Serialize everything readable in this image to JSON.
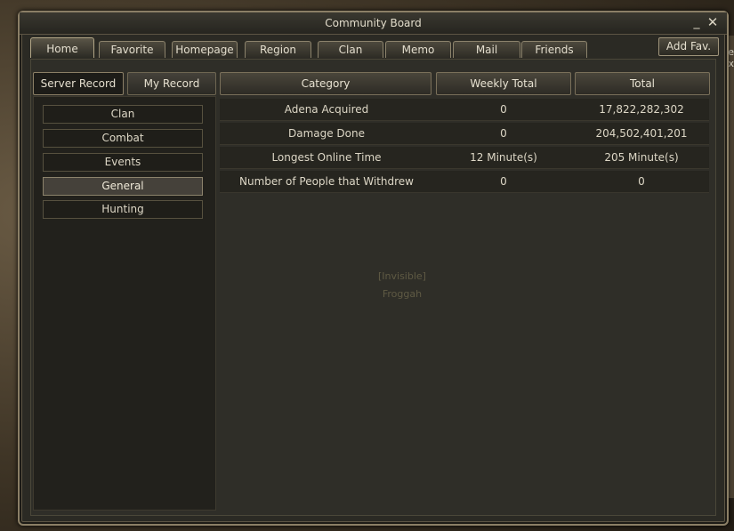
{
  "window": {
    "title": "Community Board"
  },
  "controls": {
    "minimize": "_",
    "close": "✕"
  },
  "tabs": [
    {
      "label": "Home",
      "active": true
    },
    {
      "label": "Favorite",
      "active": false
    },
    {
      "label": "Homepage",
      "active": false
    },
    {
      "label": "Region",
      "active": false
    },
    {
      "label": "Clan",
      "active": false
    },
    {
      "label": "Memo",
      "active": false
    },
    {
      "label": "Mail",
      "active": false
    },
    {
      "label": "Friends",
      "active": false
    }
  ],
  "add_fav": "Add Fav.",
  "subtabs": {
    "server_record": "Server Record",
    "my_record": "My Record"
  },
  "categories": [
    {
      "label": "Clan",
      "active": false
    },
    {
      "label": "Combat",
      "active": false
    },
    {
      "label": "Events",
      "active": false
    },
    {
      "label": "General",
      "active": true
    },
    {
      "label": "Hunting",
      "active": false
    }
  ],
  "table": {
    "headers": [
      "Category",
      "Weekly Total",
      "Total"
    ],
    "rows": [
      [
        "Adena Acquired",
        "0",
        "17,822,282,302"
      ],
      [
        "Damage Done",
        "0",
        "204,502,401,201"
      ],
      [
        "Longest Online Time",
        "12 Minute(s)",
        "205 Minute(s)"
      ],
      [
        "Number of People that Withdrew",
        "0",
        "0"
      ]
    ]
  },
  "background_text": {
    "status": "[Invisible]",
    "name": "Froggah"
  },
  "edge_text": "ire\nx"
}
